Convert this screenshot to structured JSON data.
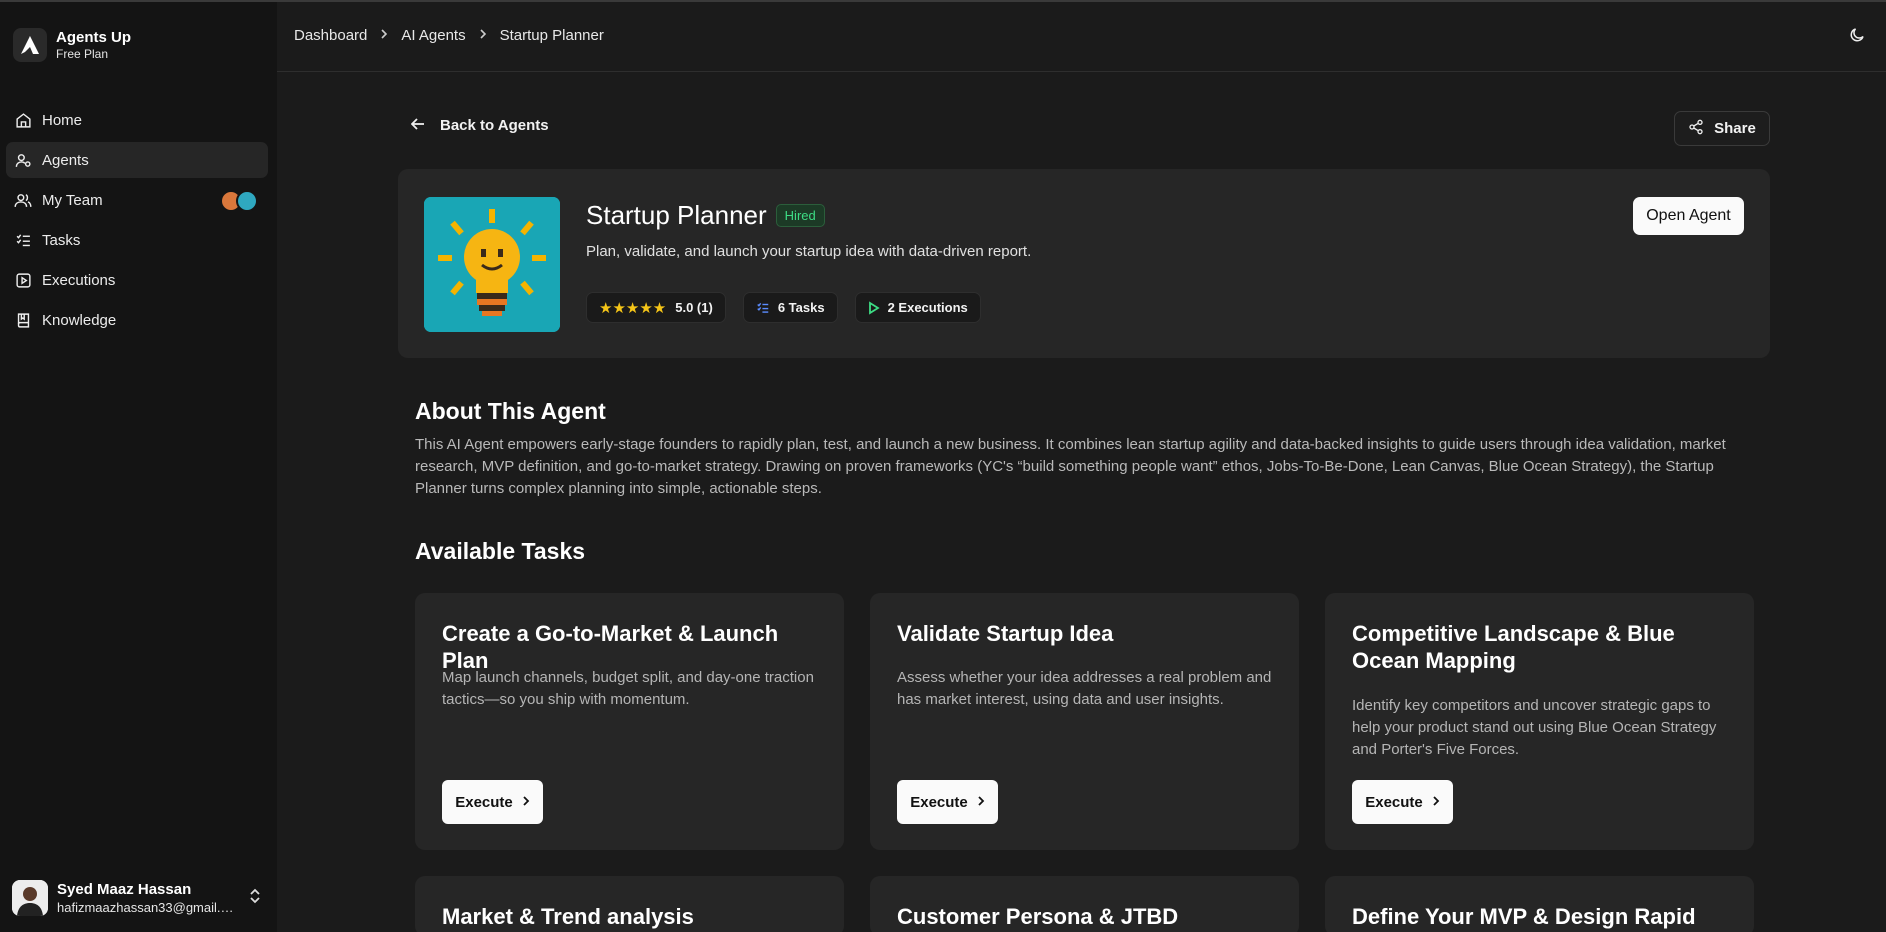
{
  "brand": {
    "name": "Agents Up",
    "plan": "Free Plan"
  },
  "sidebar": {
    "items": [
      {
        "label": "Home",
        "icon": "home-icon"
      },
      {
        "label": "Agents",
        "icon": "agents-icon",
        "active": true
      },
      {
        "label": "My Team",
        "icon": "team-icon"
      },
      {
        "label": "Tasks",
        "icon": "tasks-icon"
      },
      {
        "label": "Executions",
        "icon": "executions-icon"
      },
      {
        "label": "Knowledge",
        "icon": "book-icon"
      }
    ]
  },
  "user": {
    "name": "Syed Maaz Hassan",
    "email": "hafizmaazhassan33@gmail.c..."
  },
  "breadcrumb": [
    "Dashboard",
    "AI Agents",
    "Startup Planner"
  ],
  "back_label": "Back to Agents",
  "share_label": "Share",
  "agent": {
    "title": "Startup Planner",
    "badge": "Hired",
    "description": "Plan, validate, and launch your startup idea with data-driven report.",
    "rating": "5.0 (1)",
    "rating_stars": "★★★★★",
    "tasks": "6 Tasks",
    "executions": "2 Executions",
    "open_label": "Open Agent"
  },
  "about": {
    "title": "About This Agent",
    "text": "This AI Agent empowers early-stage founders to rapidly plan, test, and launch a new business. It combines lean startup agility and data-backed insights to guide users through idea validation, market research, MVP definition, and go-to-market strategy. Drawing on proven frameworks (YC's “build something people want” ethos, Jobs-To-Be-Done, Lean Canvas, Blue Ocean Strategy), the Startup Planner turns complex planning into simple, actionable steps."
  },
  "tasks_section": {
    "title": "Available Tasks",
    "execute_label": "Execute",
    "cards": [
      {
        "title": "Create a Go-to-Market & Launch Plan",
        "desc": "Map launch channels, budget split, and day-one traction tactics—so you ship with momentum."
      },
      {
        "title": "Validate Startup Idea",
        "desc": "Assess whether your idea addresses a real problem and has market interest, using data and user insights."
      },
      {
        "title": "Competitive Landscape & Blue Ocean Mapping",
        "desc": "Identify key competitors and uncover strategic gaps to help your product stand out using Blue Ocean Strategy and Porter's Five Forces."
      },
      {
        "title": "Market & Trend analysis"
      },
      {
        "title": "Customer Persona & JTBD Definition"
      },
      {
        "title": "Define Your MVP & Design Rapid"
      }
    ]
  },
  "colors": {
    "accent_green": "#3ddc84",
    "agent_bg": "#19a6b5",
    "star": "#f5c518"
  }
}
